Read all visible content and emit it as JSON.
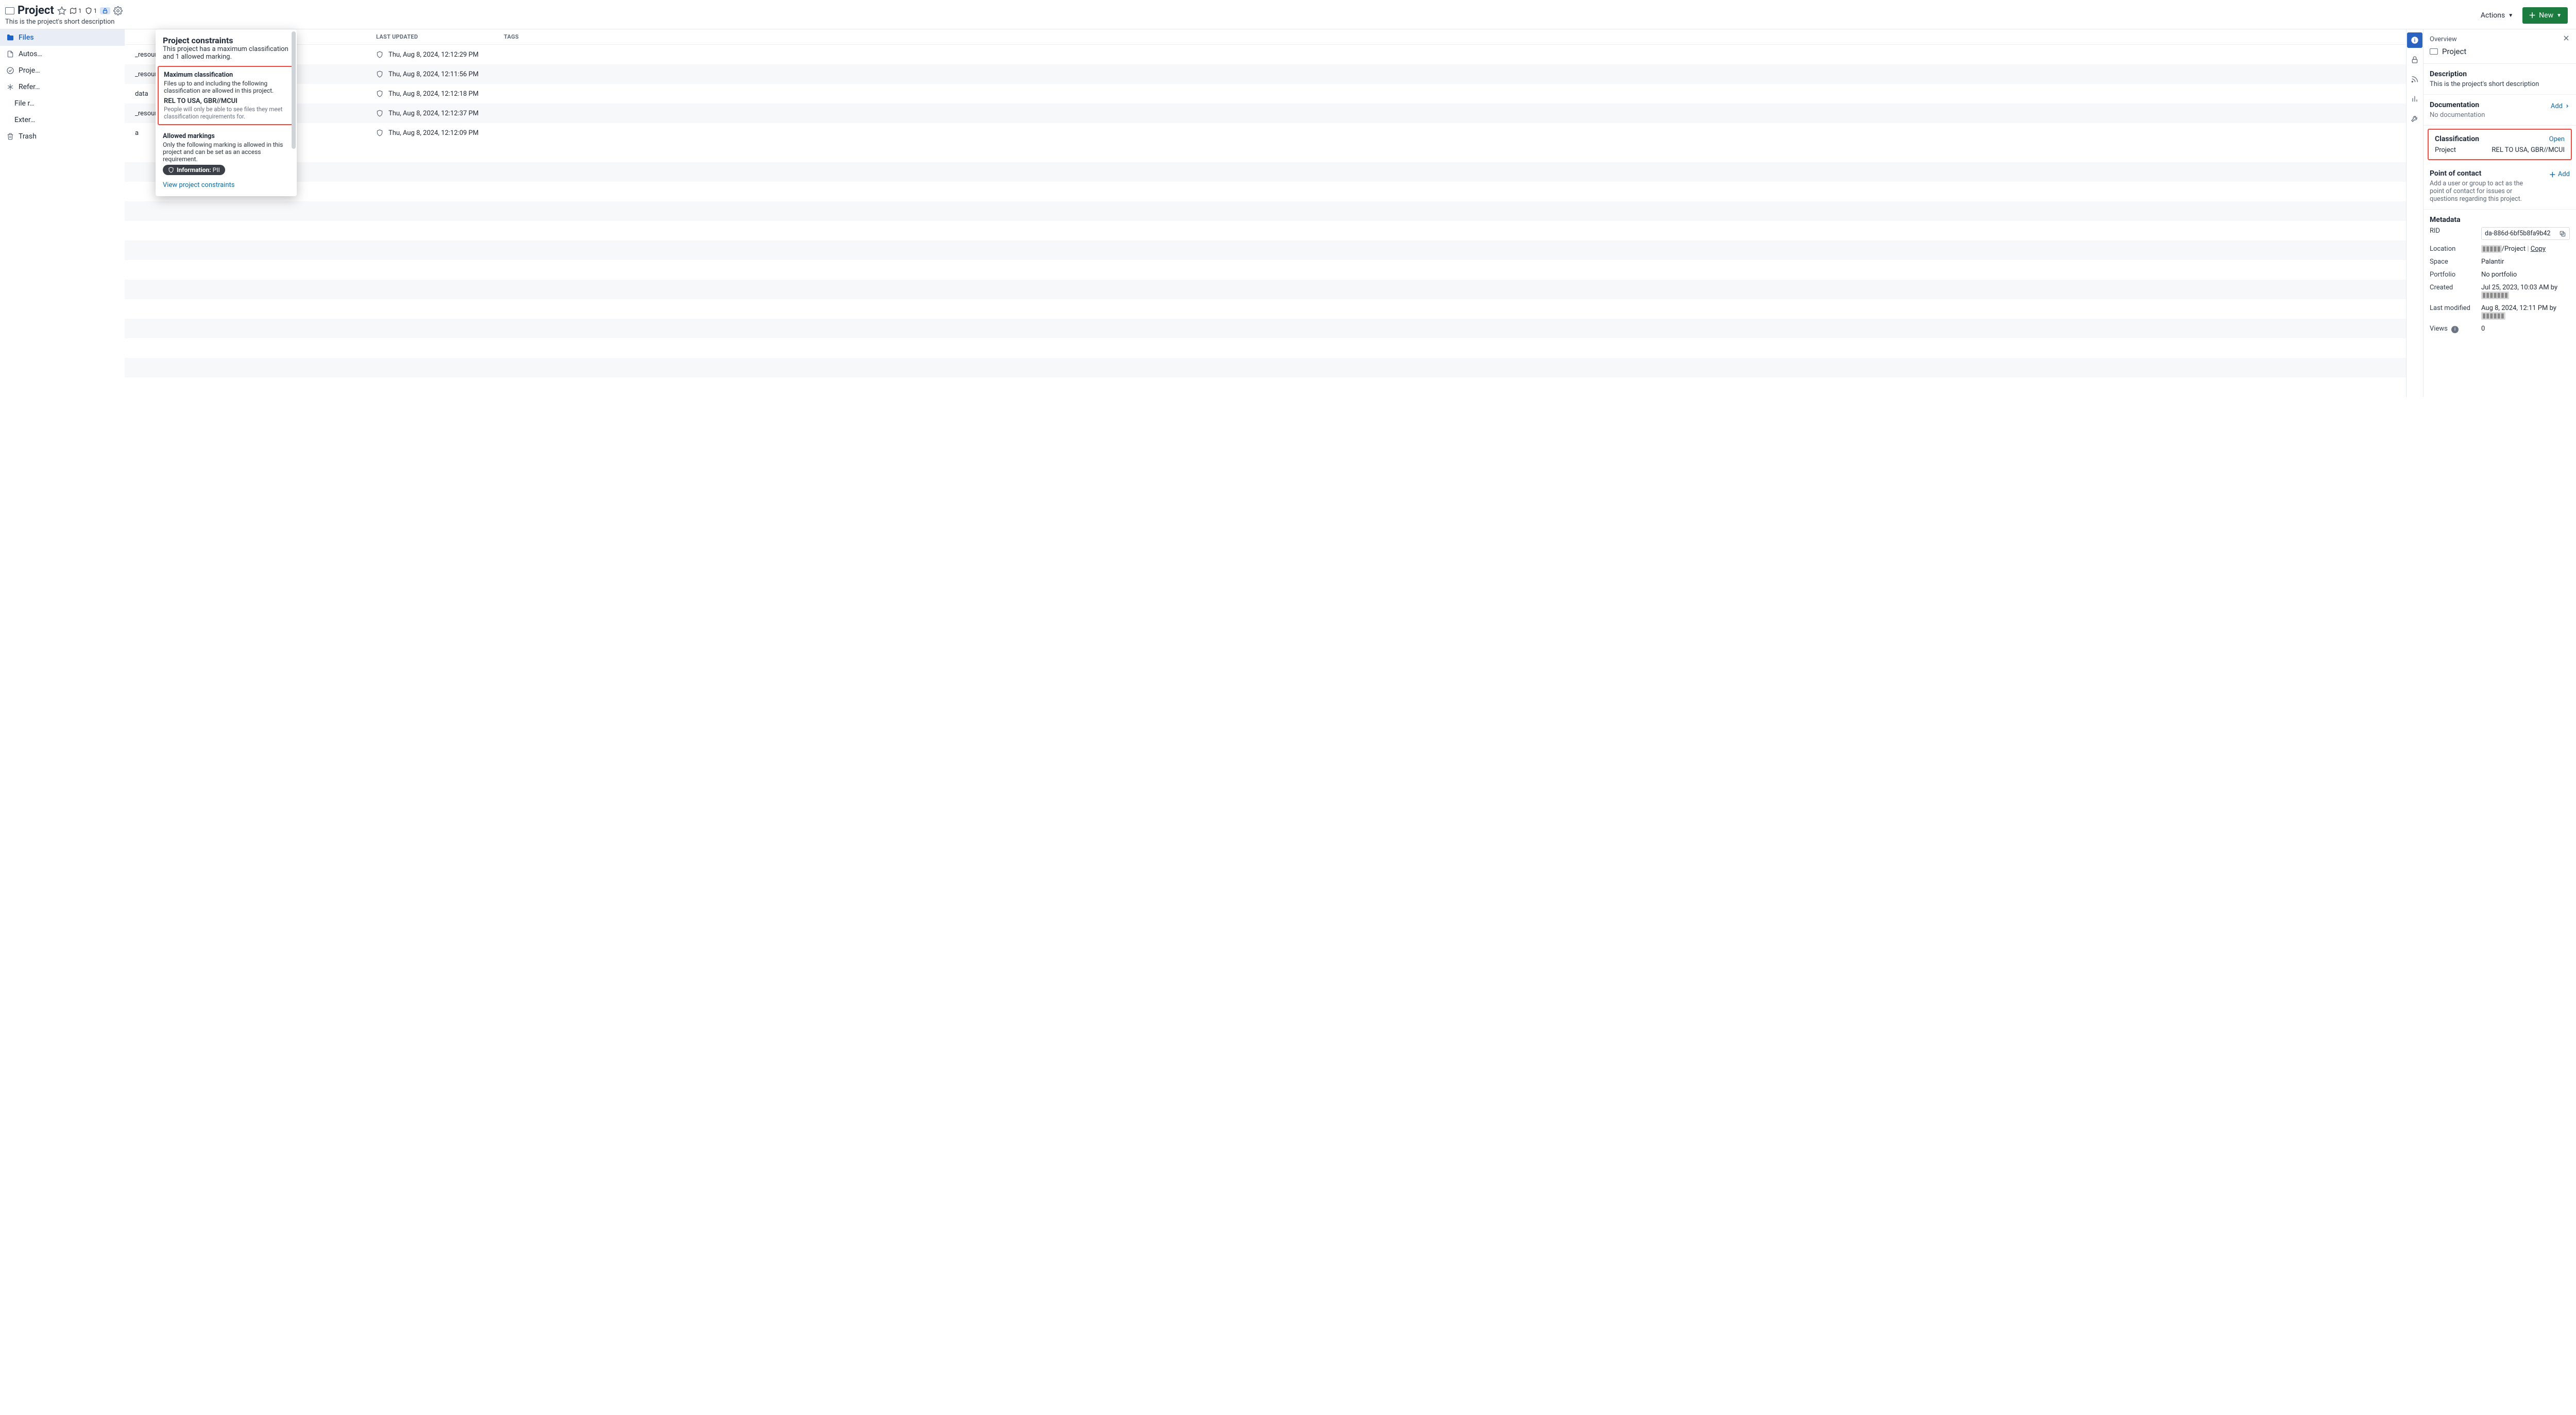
{
  "header": {
    "title": "Project",
    "subtitle": "This is the project's short description",
    "map_count": "1",
    "shield_count": "1",
    "actions_label": "Actions",
    "new_label": "New"
  },
  "sidebar": {
    "items": [
      {
        "label": "Files",
        "icon": "folder",
        "active": true
      },
      {
        "label": "Autos…",
        "icon": "doc"
      },
      {
        "label": "Proje…",
        "icon": "checkbadge"
      },
      {
        "label": "Refer…",
        "icon": "asterisk"
      },
      {
        "label": "File r…",
        "sub": true
      },
      {
        "label": "Exter…",
        "sub": true
      },
      {
        "label": "Trash",
        "icon": "trash"
      }
    ]
  },
  "columns": {
    "updated": "LAST UPDATED",
    "tags": "TAGS"
  },
  "files": [
    {
      "name": "_resource",
      "updated": "Thu, Aug 8, 2024, 12:12:29 PM"
    },
    {
      "name": "_resource.jpg",
      "updated": "Thu, Aug 8, 2024, 12:11:56 PM"
    },
    {
      "name": "data",
      "updated": "Thu, Aug 8, 2024, 12:12:18 PM"
    },
    {
      "name": "_resource",
      "updated": "Thu, Aug 8, 2024, 12:12:37 PM"
    },
    {
      "name": "a",
      "updated": "Thu, Aug 8, 2024, 12:12:09 PM"
    }
  ],
  "popover": {
    "title": "Project constraints",
    "desc": "This project has a maximum classification and 1 allowed marking.",
    "max_class_title": "Maximum classification",
    "max_class_note": "Files up to and including the following classification are allowed in this project.",
    "max_class_value": "REL TO USA, GBR//MCUI",
    "max_class_hint": "People will only be able to see files they meet classification requirements for.",
    "allowed_title": "Allowed markings",
    "allowed_note": "Only the following marking is allowed in this project and can be set as an access requirement.",
    "marking_label": "Information: ",
    "marking_value": "PII",
    "link": "View project constraints"
  },
  "details": {
    "overview_label": "Overview",
    "project_label": "Project",
    "description_title": "Description",
    "description_text": "This is the project's short description",
    "documentation_title": "Documentation",
    "documentation_add": "Add",
    "documentation_none": "No documentation",
    "classification_title": "Classification",
    "classification_open": "Open",
    "classification_scope": "Project",
    "classification_value": "REL TO USA, GBR//MCUI",
    "poc_title": "Point of contact",
    "poc_text": "Add a user or group to act as the point of contact for issues or questions regarding this project.",
    "poc_add": "Add",
    "metadata_title": "Metadata",
    "rid_label": "RID",
    "rid_value": "da-886d-6bf5b8fa9b42",
    "location_label": "Location",
    "location_blur": "▮▮▮▮▮",
    "location_tail": "/Project",
    "location_copy": "Copy",
    "space_label": "Space",
    "space_value": "Palantir",
    "portfolio_label": "Portfolio",
    "portfolio_value": "No portfolio",
    "created_label": "Created",
    "created_value": "Jul 25, 2023, 10:03 AM by",
    "created_by_blur": "▮▮▮▮▮▮▮",
    "modified_label": "Last modified",
    "modified_value": "Aug 8, 2024, 12:11 PM by",
    "modified_by_blur": "▮▮▮▮▮▮",
    "views_label": "Views",
    "views_value": "0"
  }
}
